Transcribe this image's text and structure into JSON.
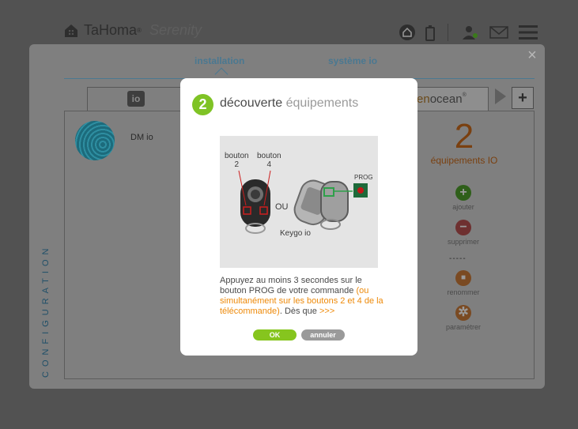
{
  "app": {
    "brand": "TaHoma",
    "reg": "®",
    "product": "Serenity"
  },
  "panel": {
    "tabs": [
      "installation",
      "système io"
    ],
    "side_label": "CONFIGURATION",
    "protocols": {
      "io_label": "io",
      "enocean_prefix": "en",
      "enocean_rest": "ocean",
      "enocean_mark": "®"
    },
    "device": {
      "name": "DM io"
    },
    "summary": {
      "count": "2",
      "label": "équipements IO"
    },
    "actions": [
      {
        "label": "ajouter",
        "icon": "plus-icon"
      },
      {
        "label": "supprimer",
        "icon": "minus-icon"
      },
      {
        "label": "renommer",
        "icon": "rename-icon"
      },
      {
        "label": "paramétrer",
        "icon": "gear-icon"
      }
    ],
    "separator": "-----"
  },
  "modal": {
    "step": "2",
    "title_part1": "découverte",
    "title_part2": "équipements",
    "illustration": {
      "label_btn2_a": "bouton",
      "label_btn2_b": "2",
      "label_btn4_a": "bouton",
      "label_btn4_b": "4",
      "label_or": "OU",
      "label_prog": "PROG",
      "label_keygo": "Keygo io"
    },
    "text_normal_1": "Appuyez au moins 3 secondes sur le bouton PROG de votre commande ",
    "text_highlight": "(ou simultanément sur les boutons 2 et 4 de la télécommande)",
    "text_normal_2": ". Dès que  ",
    "text_more": ">>>",
    "ok_label": "OK",
    "cancel_label": "annuler"
  },
  "colors": {
    "accent_green": "#7fc325",
    "accent_orange": "#ee8a0a",
    "brand_blue": "#4a7891"
  }
}
